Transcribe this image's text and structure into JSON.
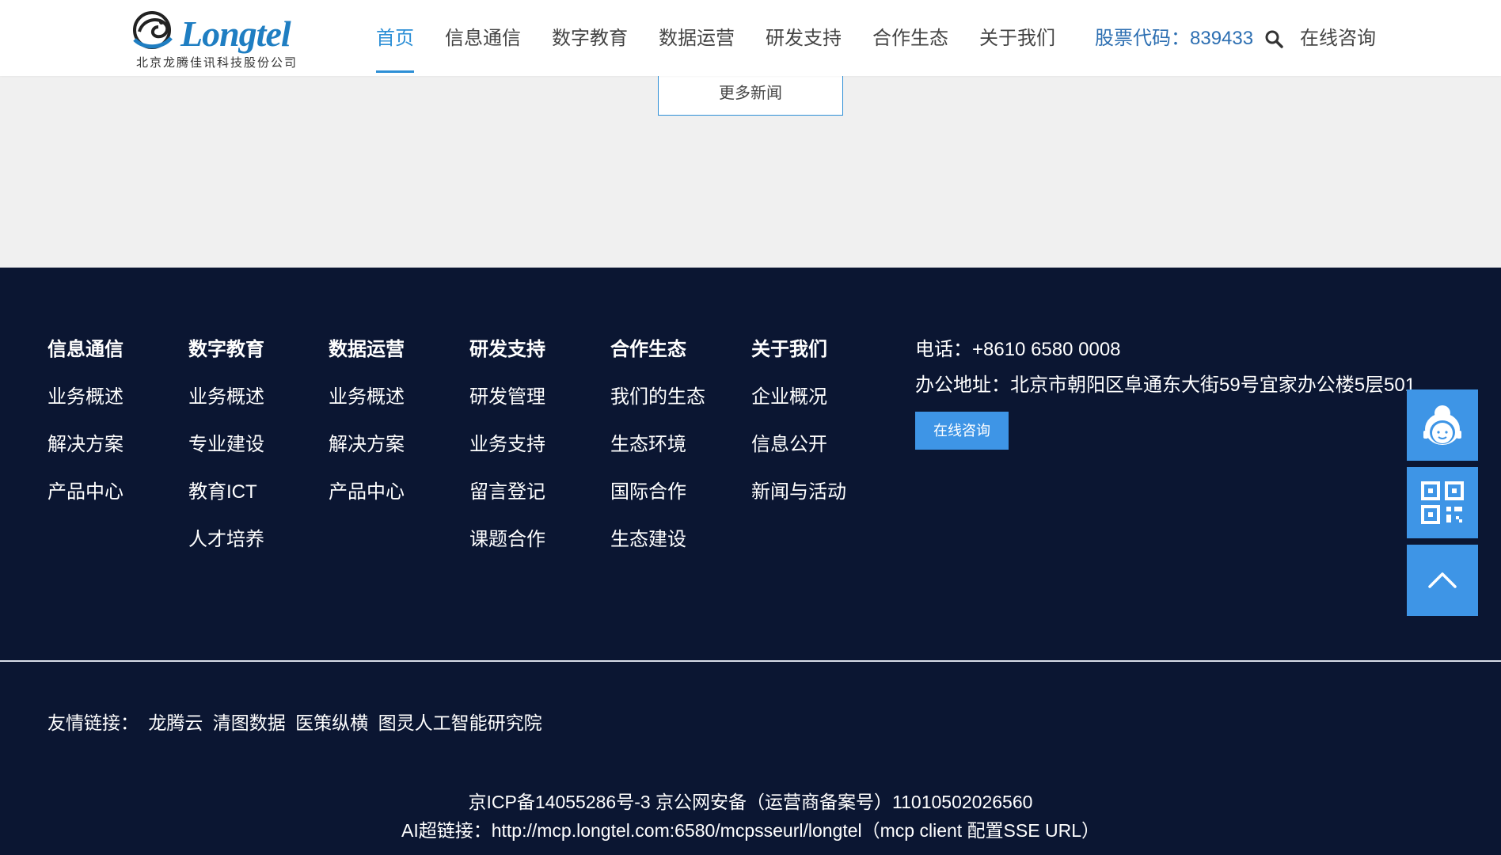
{
  "header": {
    "logo_word": "Longtel",
    "logo_sub": "北京龙腾佳讯科技股份公司",
    "nav": [
      "首页",
      "信息通信",
      "数字教育",
      "数据运营",
      "研发支持",
      "合作生态",
      "关于我们"
    ],
    "stock": "股票代码：839433",
    "consult": "在线咨询"
  },
  "main": {
    "more_news": "更多新闻"
  },
  "footer": {
    "columns": [
      {
        "title": "信息通信",
        "links": [
          "业务概述",
          "解决方案",
          "产品中心"
        ]
      },
      {
        "title": "数字教育",
        "links": [
          "业务概述",
          "专业建设",
          "教育ICT",
          "人才培养"
        ]
      },
      {
        "title": "数据运营",
        "links": [
          "业务概述",
          "解决方案",
          "产品中心"
        ]
      },
      {
        "title": "研发支持",
        "links": [
          "研发管理",
          "业务支持",
          "留言登记",
          "课题合作"
        ]
      },
      {
        "title": "合作生态",
        "links": [
          "我们的生态",
          "生态环境",
          "国际合作",
          "生态建设"
        ]
      },
      {
        "title": "关于我们",
        "links": [
          "企业概况",
          "信息公开",
          "新闻与活动"
        ]
      }
    ],
    "phone": "电话：+8610 6580 0008",
    "address": "办公地址：北京市朝阳区阜通东大街59号宜家办公楼5层501",
    "consult_button": "在线咨询",
    "friend_links_label": "友情链接：",
    "friend_links": [
      "龙腾云",
      "清图数据",
      "医策纵横",
      "图灵人工智能研究院"
    ],
    "icp": "京ICP备14055286号-3 京公网安备（运营商备案号）11010502026560",
    "mcp": "AI超链接：http://mcp.longtel.com:6580/mcpsseurl/longtel（mcp client 配置SSE URL）"
  },
  "side": {
    "icons": [
      "customer-service-icon",
      "qr-code-icon",
      "arrow-up-icon"
    ]
  },
  "colors": {
    "brand": "#2d8fd6",
    "footer_bg": "#0b1632",
    "button": "#3e95e6"
  }
}
